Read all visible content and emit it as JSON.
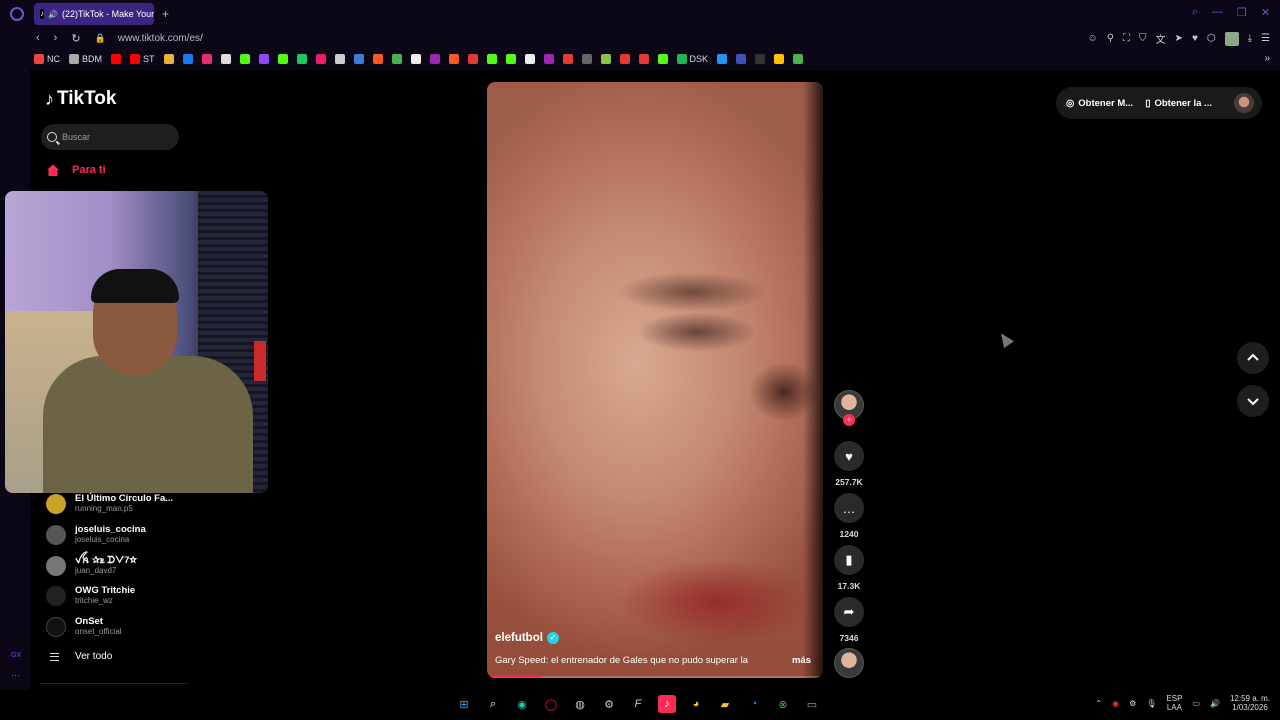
{
  "browser": {
    "tab_title": "(22)TikTok - Make Your",
    "url": "www.tiktok.com/es/",
    "new_tab": "+",
    "bookmarks": [
      {
        "label": "NC",
        "color": "#e44"
      },
      {
        "label": "BDM",
        "color": "#aaa"
      },
      {
        "label": "",
        "color": "#f00"
      },
      {
        "label": "ST",
        "color": "#f00"
      },
      {
        "label": "",
        "color": "#e8b339"
      },
      {
        "label": "",
        "color": "#1877f2"
      },
      {
        "label": "",
        "color": "#e1306c"
      },
      {
        "label": "",
        "color": "#ddd"
      },
      {
        "label": "",
        "color": "#53fc18"
      },
      {
        "label": "",
        "color": "#9146ff"
      },
      {
        "label": "",
        "color": "#53fc18"
      },
      {
        "label": "",
        "color": "#18c964"
      },
      {
        "label": "",
        "color": "#e91e63"
      },
      {
        "label": "",
        "color": "#ccc"
      },
      {
        "label": "",
        "color": "#3b7dd8"
      },
      {
        "label": "",
        "color": "#ff5722"
      },
      {
        "label": "",
        "color": "#4caf50"
      },
      {
        "label": "",
        "color": "#eee"
      },
      {
        "label": "",
        "color": "#9c27b0"
      },
      {
        "label": "",
        "color": "#ff5722"
      },
      {
        "label": "",
        "color": "#e53935"
      },
      {
        "label": "",
        "color": "#53fc18"
      },
      {
        "label": "",
        "color": "#53fc18"
      },
      {
        "label": "",
        "color": "#eee"
      },
      {
        "label": "",
        "color": "#9c27b0"
      },
      {
        "label": "",
        "color": "#e53935"
      },
      {
        "label": "",
        "color": "#666"
      },
      {
        "label": "",
        "color": "#8bc34a"
      },
      {
        "label": "",
        "color": "#e53935"
      },
      {
        "label": "",
        "color": "#e53935"
      },
      {
        "label": "",
        "color": "#53fc18"
      },
      {
        "label": "DSK",
        "color": "#1db954"
      },
      {
        "label": "",
        "color": "#2196f3"
      },
      {
        "label": "",
        "color": "#3f51b5"
      },
      {
        "label": "",
        "color": "#333"
      },
      {
        "label": "",
        "color": "#ffc107"
      },
      {
        "label": "",
        "color": "#4caf50"
      }
    ]
  },
  "tiktok": {
    "logo": "TikTok",
    "search_placeholder": "Buscar",
    "for_you": "Para ti",
    "following": [
      {
        "name": "El Último Círculo Fa...",
        "handle": "running_man.p5",
        "color": "#c9a227"
      },
      {
        "name": "joseluis_cocina",
        "handle": "joseluis_cocina",
        "color": "#555"
      },
      {
        "name": "ꪜꫝ ✰ꭱ ᗪᐯ7☆",
        "handle": "juan_davd7",
        "color": "#777"
      },
      {
        "name": "OWG Tritchie",
        "handle": "tritchie_wz",
        "color": "#222"
      },
      {
        "name": "OnSet",
        "handle": "onset_official",
        "color": "#111"
      }
    ],
    "see_all": "Ver todo",
    "video": {
      "author": "elefutbol",
      "caption": "Gary Speed: el entrenador de Gales que no pudo superar la",
      "more": "más",
      "progress": 0.16
    },
    "actions": {
      "likes": "257.7K",
      "comments": "1240",
      "saves": "17.3K",
      "shares": "7346"
    },
    "get_app": {
      "item1": "Obtener M...",
      "item2": "Obtener la ..."
    }
  },
  "system": {
    "lang1": "ESP",
    "lang2": "LAA",
    "time": "12:59 a. m.",
    "date": "1/03/2026",
    "gx": "GX"
  },
  "colors": {
    "accent": "#fe2c55",
    "opera": "#7b4dd8",
    "verified": "#20d5ec"
  }
}
